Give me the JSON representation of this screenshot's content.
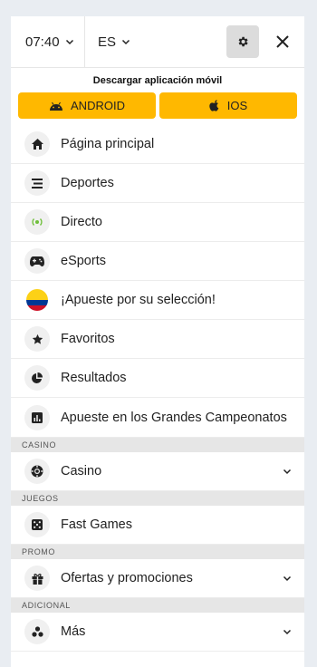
{
  "header": {
    "time": "07:40",
    "language": "ES"
  },
  "download": {
    "title": "Descargar aplicación móvil",
    "android_label": "ANDROID",
    "ios_label": "IOS"
  },
  "menu": {
    "items": [
      {
        "label": "Página principal",
        "icon": "home-icon"
      },
      {
        "label": "Deportes",
        "icon": "sports-list-icon"
      },
      {
        "label": "Directo",
        "icon": "live-icon"
      },
      {
        "label": "eSports",
        "icon": "gamepad-icon"
      },
      {
        "label": "¡Apueste por su selección!",
        "icon": "colombia-flag-icon"
      },
      {
        "label": "Favoritos",
        "icon": "star-icon"
      },
      {
        "label": "Resultados",
        "icon": "results-pie-icon"
      },
      {
        "label": "Apueste en los Grandes Campeonatos",
        "icon": "chart-icon"
      }
    ]
  },
  "sections": {
    "casino": {
      "title": "CASINO",
      "item": "Casino"
    },
    "juegos": {
      "title": "JUEGOS",
      "item": "Fast Games"
    },
    "promo": {
      "title": "PROMO",
      "item": "Ofertas y promociones"
    },
    "adicional": {
      "title": "ADICIONAL",
      "item": "Más"
    }
  },
  "colors": {
    "accent": "#ffb800",
    "live_green": "#6fbf3a",
    "background": "#e9edf2"
  }
}
